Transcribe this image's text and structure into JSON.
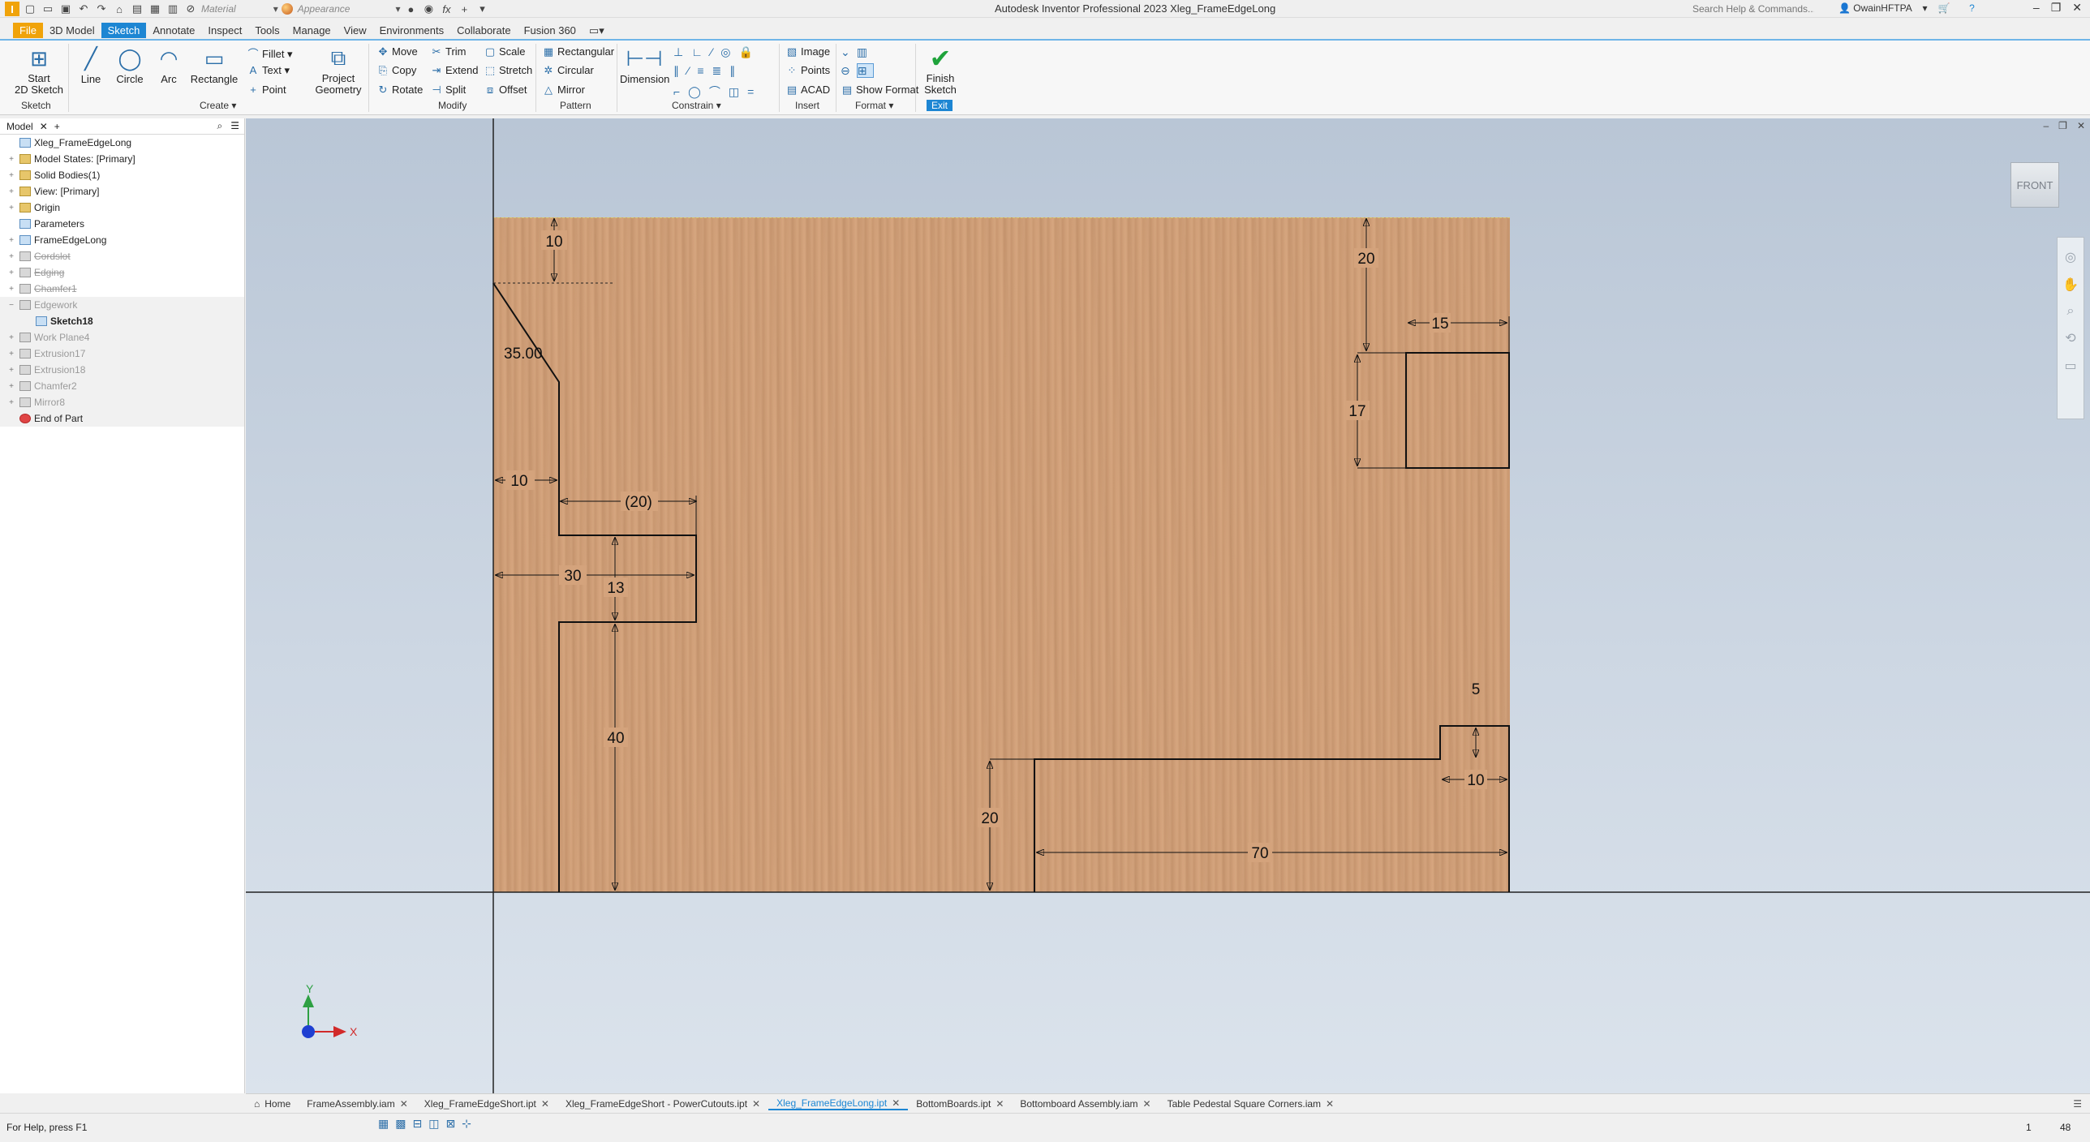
{
  "app": {
    "title": "Autodesk Inventor Professional 2023   Xleg_FrameEdgeLong",
    "material_placeholder": "Material",
    "appearance_placeholder": "Appearance",
    "search_placeholder": "Search Help & Commands...",
    "user": "OwainHFTPA"
  },
  "ribbon_tabs": [
    "File",
    "3D Model",
    "Sketch",
    "Annotate",
    "Inspect",
    "Tools",
    "Manage",
    "View",
    "Environments",
    "Collaborate",
    "Fusion 360"
  ],
  "ribbon": {
    "sketch_group": "Sketch",
    "start_sketch": "Start\n2D Sketch",
    "create_group": "Create ▾",
    "line": "Line",
    "circle": "Circle",
    "arc": "Arc",
    "rectangle": "Rectangle",
    "fillet": "Fillet ▾",
    "text": "Text ▾",
    "point": "Point",
    "project_geometry": "Project\nGeometry",
    "modify_group": "Modify",
    "move": "Move",
    "copy": "Copy",
    "rotate": "Rotate",
    "trim": "Trim",
    "extend": "Extend",
    "split": "Split",
    "scale": "Scale",
    "stretch": "Stretch",
    "offset": "Offset",
    "pattern_group": "Pattern",
    "rectangular": "Rectangular",
    "circular": "Circular",
    "mirror": "Mirror",
    "constrain_group": "Constrain ▾",
    "dimension": "Dimension",
    "insert_group": "Insert",
    "image": "Image",
    "points": "Points",
    "acad": "ACAD",
    "format_group": "Format ▾",
    "show_format": "Show Format",
    "finish_sketch": "Finish\nSketch",
    "exit_group": "Exit"
  },
  "browser": {
    "tab": "Model",
    "items": [
      {
        "label": "Xleg_FrameEdgeLong",
        "type": "doc"
      },
      {
        "label": "Model States: [Primary]",
        "type": "folder"
      },
      {
        "label": "Solid Bodies(1)",
        "type": "folder"
      },
      {
        "label": "View: [Primary]",
        "type": "folder"
      },
      {
        "label": "Origin",
        "type": "folder"
      },
      {
        "label": "Parameters",
        "type": "doc"
      },
      {
        "label": "FrameEdgeLong",
        "type": "doc"
      },
      {
        "label": "Cordslot",
        "type": "feat",
        "state": "struck"
      },
      {
        "label": "Edging",
        "type": "feat",
        "state": "struck"
      },
      {
        "label": "Chamfer1",
        "type": "feat",
        "state": "struck"
      },
      {
        "label": "Edgework",
        "type": "feat",
        "state": "dim"
      },
      {
        "label": "Sketch18",
        "type": "doc",
        "state": "bold"
      },
      {
        "label": "Work Plane4",
        "type": "feat",
        "state": "dim"
      },
      {
        "label": "Extrusion17",
        "type": "feat",
        "state": "dim"
      },
      {
        "label": "Extrusion18",
        "type": "feat",
        "state": "dim"
      },
      {
        "label": "Chamfer2",
        "type": "feat",
        "state": "dim"
      },
      {
        "label": "Mirror8",
        "type": "feat",
        "state": "dim"
      },
      {
        "label": "End of Part",
        "type": "end"
      }
    ]
  },
  "viewport": {
    "viewcube": "FRONT",
    "axis_x": "X",
    "axis_y": "Y"
  },
  "dimensions": {
    "d_top_left": "10",
    "d_angle": "35.00",
    "d_left_10": "10",
    "d_ref_20": "(20)",
    "d_30": "30",
    "d_13": "13",
    "d_40": "40",
    "d_top_right_20": "20",
    "d_15": "15",
    "d_17": "17",
    "d_5": "5",
    "d_bottom_10": "10",
    "d_bottom_20": "20",
    "d_70": "70"
  },
  "doc_tabs": [
    {
      "label": "Home",
      "close": false
    },
    {
      "label": "FrameAssembly.iam",
      "close": true
    },
    {
      "label": "Xleg_FrameEdgeShort.ipt",
      "close": true
    },
    {
      "label": "Xleg_FrameEdgeShort - PowerCutouts.ipt",
      "close": true
    },
    {
      "label": "Xleg_FrameEdgeLong.ipt",
      "close": true,
      "active": true
    },
    {
      "label": "BottomBoards.ipt",
      "close": true
    },
    {
      "label": "Bottomboard Assembly.iam",
      "close": true
    },
    {
      "label": "Table Pedestal Square Corners.iam",
      "close": true
    }
  ],
  "status": {
    "help": "For Help, press F1",
    "n1": "1",
    "n2": "48"
  }
}
